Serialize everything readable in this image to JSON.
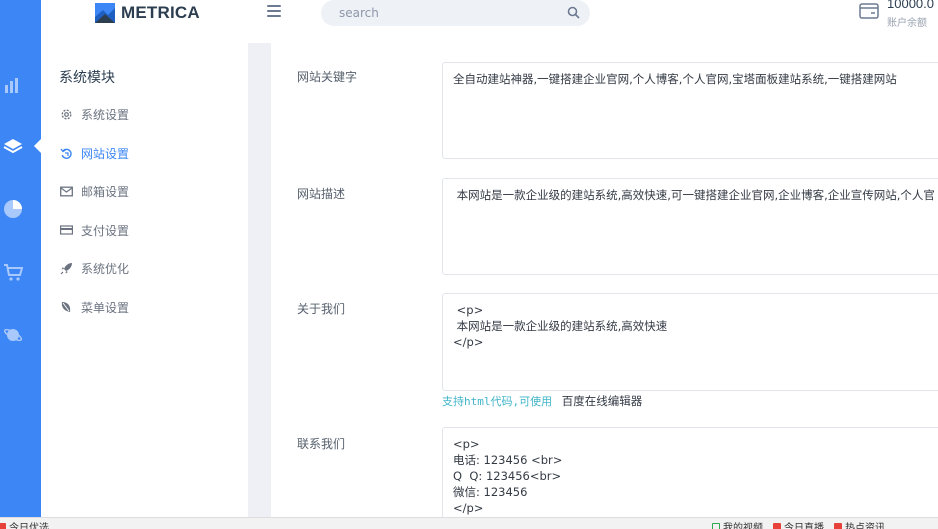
{
  "header": {
    "logo_text": "METRICA",
    "search_placeholder": "search",
    "balance_value": "10000.0",
    "balance_label": "账户余额"
  },
  "rail": {
    "items": [
      {
        "icon": "bar-chart-icon"
      },
      {
        "icon": "layers-icon",
        "active": true
      },
      {
        "icon": "pie-chart-icon"
      },
      {
        "icon": "cart-icon"
      },
      {
        "icon": "planet-icon"
      }
    ]
  },
  "sidebar": {
    "title": "系统模块",
    "items": [
      {
        "label": "系统设置",
        "icon": "gear-icon"
      },
      {
        "label": "网站设置",
        "icon": "refresh-icon",
        "active": true
      },
      {
        "label": "邮箱设置",
        "icon": "mail-icon"
      },
      {
        "label": "支付设置",
        "icon": "card-icon"
      },
      {
        "label": "系统优化",
        "icon": "rocket-icon"
      },
      {
        "label": "菜单设置",
        "icon": "leaf-icon"
      }
    ]
  },
  "form": {
    "keywords": {
      "label": "网站关键字",
      "value": "全自动建站神器,一键搭建企业官网,个人博客,个人官网,宝塔面板建站系统,一键搭建网站"
    },
    "description": {
      "label": "网站描述",
      "value": " 本网站是一款企业级的建站系统,高效快速,可一键搭建企业官网,企业博客,企业宣传网站,个人官"
    },
    "about": {
      "label": "关于我们",
      "lines": [
        " <p>",
        " 本网站是一款企业级的建站系统,高效快速",
        "</p>"
      ]
    },
    "help": {
      "code_text": "支持html代码,可使用",
      "link_text": "百度在线编辑器"
    },
    "contact": {
      "label": "联系我们",
      "lines": [
        "<p>",
        "电话: 123456 <br>",
        "Q  Q: 123456<br>",
        "微信: 123456",
        "</p>"
      ]
    }
  },
  "statusbar": {
    "left_label": "今日优选",
    "right_items": [
      {
        "label": "我的视频",
        "color": "#2fa84f"
      },
      {
        "label": "今日直播",
        "color": "#e8413a"
      },
      {
        "label": "热点资讯",
        "color": "#e8413a"
      }
    ]
  }
}
